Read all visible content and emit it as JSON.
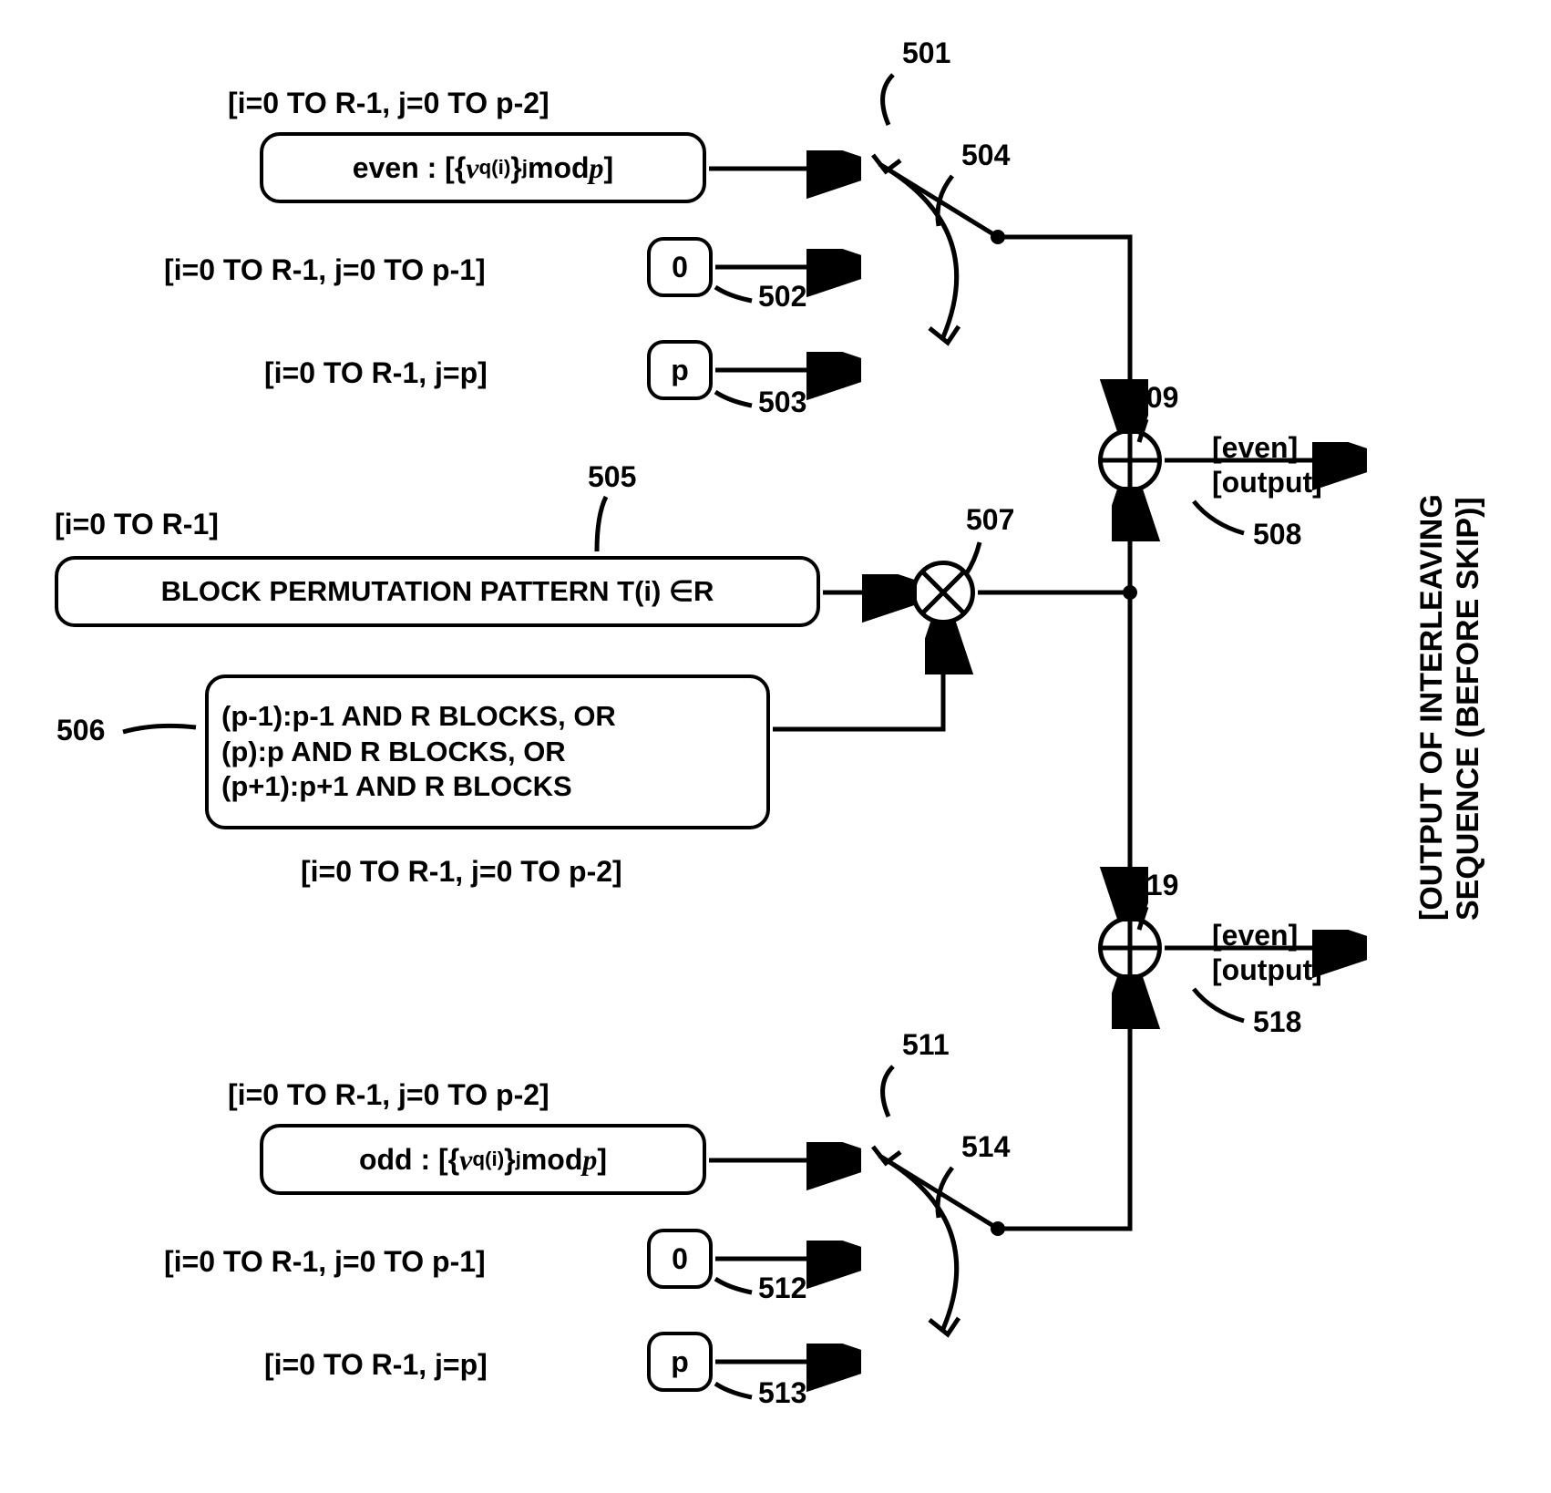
{
  "refs": {
    "r501": "501",
    "r502": "502",
    "r503": "503",
    "r504": "504",
    "r505": "505",
    "r506": "506",
    "r507": "507",
    "r508": "508",
    "r509": "509",
    "r511": "511",
    "r512": "512",
    "r513": "513",
    "r514": "514",
    "r518": "518",
    "r519": "519"
  },
  "ranges": {
    "r501_range": "[i=0 TO R-1, j=0 TO p-2]",
    "r502_range": "[i=0 TO R-1, j=0 TO p-1]",
    "r503_range": "[i=0 TO R-1, j=p]",
    "r505_range": "[i=0 TO R-1]",
    "r506_range": "[i=0 TO R-1, j=0 TO p-2]",
    "r511_range": "[i=0 TO R-1, j=0 TO p-2]",
    "r512_range": "[i=0 TO R-1, j=0 TO p-1]",
    "r513_range": "[i=0 TO R-1, j=p]"
  },
  "boxes": {
    "b501_prefix": "even : [{",
    "b501_nu": "ν",
    "b501_exp": " q(i)",
    "b501_mid": "}",
    "b501_j": "j",
    "b501_suffix": " mod ",
    "b501_p": "p",
    "b501_end": "]",
    "b502": "0",
    "b503": "p",
    "b505": "BLOCK PERMUTATION PATTERN T(i) ∈R",
    "b506_l1": "(p-1):p-1 AND R BLOCKS, OR",
    "b506_l2": "(p):p AND R BLOCKS, OR",
    "b506_l3": "(p+1):p+1 AND R BLOCKS",
    "b511_prefix": "odd : [{",
    "b511_nu": "ν",
    "b511_exp": " q(i)",
    "b511_mid": "}",
    "b511_j": "j",
    "b511_suffix": " mod ",
    "b511_p": "p",
    "b511_end": "]",
    "b512": "0",
    "b513": "p"
  },
  "outputs": {
    "even": "[even]",
    "output": "[output]"
  },
  "side_label_l1": "[OUTPUT OF INTERLEAVING",
  "side_label_l2": "SEQUENCE (BEFORE SKIP)]",
  "chart_data": {
    "type": "block-diagram",
    "nodes": [
      {
        "id": 501,
        "kind": "formula-box",
        "label": "even : [{ν^q(i)}^j mod p]",
        "index_range": "i=0..R-1, j=0..p-2"
      },
      {
        "id": 502,
        "kind": "const-box",
        "label": "0",
        "index_range": "i=0..R-1, j=0..p-1"
      },
      {
        "id": 503,
        "kind": "const-box",
        "label": "p",
        "index_range": "i=0..R-1, j=p"
      },
      {
        "id": 504,
        "kind": "mux",
        "inputs_from": [
          501,
          502,
          503
        ]
      },
      {
        "id": 505,
        "kind": "block",
        "label": "BLOCK PERMUTATION PATTERN T(i) ∈ R",
        "index_range": "i=0..R-1"
      },
      {
        "id": 506,
        "kind": "block",
        "label": "(p-1):p-1 AND R BLOCKS, OR (p):p AND R BLOCKS, OR (p+1):p+1 AND R BLOCKS",
        "index_range": "i=0..R-1, j=0..p-2"
      },
      {
        "id": 507,
        "kind": "multiply",
        "inputs_from": [
          505,
          506
        ]
      },
      {
        "id": 508,
        "kind": "output-label",
        "label": "[even][output]"
      },
      {
        "id": 509,
        "kind": "add",
        "inputs_from": [
          504,
          507
        ],
        "output": "OUTPUT OF INTERLEAVING SEQUENCE (BEFORE SKIP)"
      },
      {
        "id": 511,
        "kind": "formula-box",
        "label": "odd : [{ν^q(i)}^j mod p]",
        "index_range": "i=0..R-1, j=0..p-2"
      },
      {
        "id": 512,
        "kind": "const-box",
        "label": "0",
        "index_range": "i=0..R-1, j=0..p-1"
      },
      {
        "id": 513,
        "kind": "const-box",
        "label": "p",
        "index_range": "i=0..R-1, j=p"
      },
      {
        "id": 514,
        "kind": "mux",
        "inputs_from": [
          511,
          512,
          513
        ]
      },
      {
        "id": 518,
        "kind": "output-label",
        "label": "[even][output]"
      },
      {
        "id": 519,
        "kind": "add",
        "inputs_from": [
          514,
          507
        ],
        "output": "OUTPUT OF INTERLEAVING SEQUENCE (BEFORE SKIP)"
      }
    ],
    "edges": [
      {
        "from": 501,
        "to": 504
      },
      {
        "from": 502,
        "to": 504
      },
      {
        "from": 503,
        "to": 504
      },
      {
        "from": 504,
        "to": 509
      },
      {
        "from": 505,
        "to": 507
      },
      {
        "from": 506,
        "to": 507
      },
      {
        "from": 507,
        "to": 509
      },
      {
        "from": 507,
        "to": 519
      },
      {
        "from": 511,
        "to": 514
      },
      {
        "from": 512,
        "to": 514
      },
      {
        "from": 513,
        "to": 514
      },
      {
        "from": 514,
        "to": 519
      },
      {
        "from": 509,
        "to": "output_even"
      },
      {
        "from": 519,
        "to": "output_odd"
      }
    ]
  }
}
